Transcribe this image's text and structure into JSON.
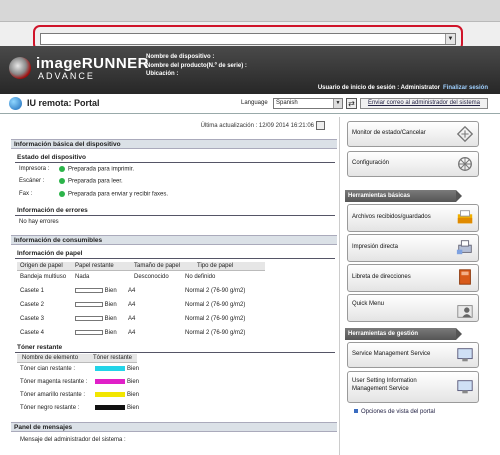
{
  "address_bar": {
    "value": "",
    "dropdown_icon": "chevron-down-icon"
  },
  "header": {
    "logo_line1": "imageRUNNER",
    "logo_line2": "ADVANCE",
    "device_name_label": "Nombre de dispositivo :",
    "product_name_label": "Nombre del producto(N.º de serie) :",
    "location_label": "Ubicación :",
    "login_user": "Usuario de inicio de sesión : Administrator",
    "logout": "Finalizar sesión"
  },
  "portal_bar": {
    "title": "IU remota: Portal",
    "language_label": "Language",
    "language_value": "Spanish",
    "mail_admin": "Enviar correo al administrador del sistema"
  },
  "main": {
    "last_update": "Última actualización : 12/09 2014 16:21:06",
    "basic_info_title": "Información básica del dispositivo",
    "device_status_title": "Estado del dispositivo",
    "status_rows": [
      {
        "label": "Impresora :",
        "value": "Preparada para imprimir."
      },
      {
        "label": "Escáner :",
        "value": "Preparada para leer."
      },
      {
        "label": "Fax :",
        "value": "Preparada para enviar y recibir faxes."
      }
    ],
    "error_info_title": "Información de errores",
    "no_errors": "No hay errores",
    "consumables_title": "Información de consumibles",
    "paper_info_title": "Información de papel",
    "paper_headers": [
      "Origen de papel",
      "Papel restante",
      "Tamaño de papel",
      "Tipo de papel"
    ],
    "paper_rows": [
      {
        "source": "Bandeja multiuso",
        "remaining": "Nada",
        "size": "Desconocido",
        "type": "No definido"
      },
      {
        "source": "Casete 1",
        "remaining": "Bien",
        "size": "A4",
        "type": "Normal 2 (76-90 g/m2)"
      },
      {
        "source": "Casete 2",
        "remaining": "Bien",
        "size": "A4",
        "type": "Normal 2 (76-90 g/m2)"
      },
      {
        "source": "Casete 3",
        "remaining": "Bien",
        "size": "A4",
        "type": "Normal 2 (76-90 g/m2)"
      },
      {
        "source": "Casete 4",
        "remaining": "Bien",
        "size": "A4",
        "type": "Normal 2 (76-90 g/m2)"
      }
    ],
    "toner_title": "Tóner restante",
    "toner_headers": [
      "Nombre de elemento",
      "Tóner restante"
    ],
    "toner_rows": [
      {
        "name": "Tóner cian restante :",
        "value": "Bien",
        "color": "#22d4e8"
      },
      {
        "name": "Tóner magenta restante :",
        "value": "Bien",
        "color": "#e020c8"
      },
      {
        "name": "Tóner amarillo restante :",
        "value": "Bien",
        "color": "#f2e600"
      },
      {
        "name": "Tóner negro restante :",
        "value": "Bien",
        "color": "#111111"
      }
    ],
    "messages_title": "Panel de mensajes",
    "admin_message_label": "Mensaje del administrador del sistema :"
  },
  "sidebar": {
    "monitor": "Monitor de estado/Cancelar",
    "settings": "Configuración",
    "basic_tools_title": "Herramientas básicas",
    "basic_tools": [
      "Archivos recibidos/guardados",
      "Impresión directa",
      "Libreta de direcciones",
      "Quick Menu"
    ],
    "management_title": "Herramientas de gestión",
    "management_tools": [
      "Service Management Service",
      "User Setting Information Management Service"
    ],
    "portal_options": "Opciones de vista del portal"
  },
  "colors": {
    "highlight": "#d0142a",
    "status_ok": "#2cb44a"
  }
}
